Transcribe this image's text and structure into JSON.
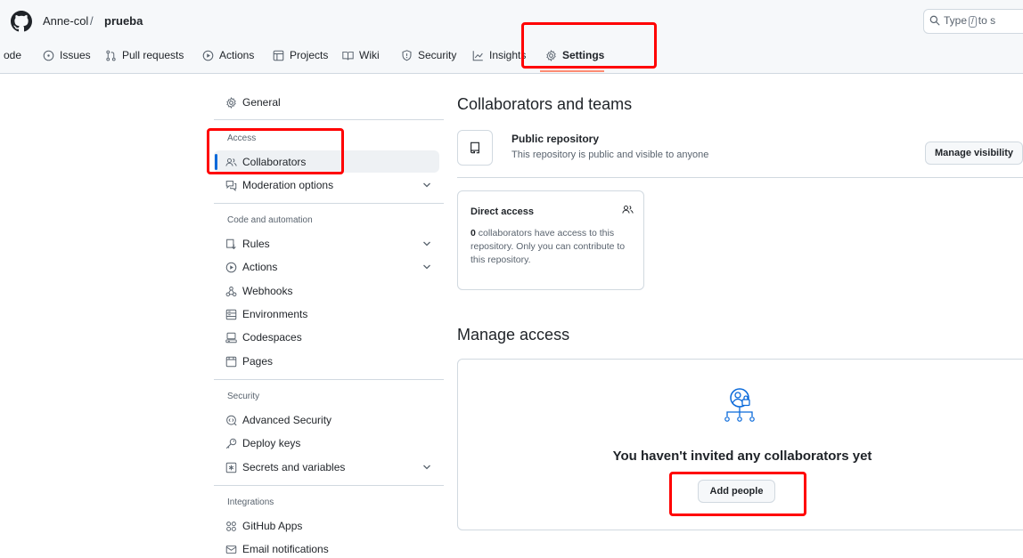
{
  "header": {
    "owner": "Anne-col",
    "separator": "/",
    "repo": "prueba",
    "search_prefix": "Type",
    "search_key": "/",
    "search_suffix": "to s"
  },
  "tabs": [
    {
      "label": "ode",
      "icon": "code-icon"
    },
    {
      "label": "Issues",
      "icon": "issue-icon"
    },
    {
      "label": "Pull requests",
      "icon": "pull-request-icon"
    },
    {
      "label": "Actions",
      "icon": "play-icon"
    },
    {
      "label": "Projects",
      "icon": "table-icon"
    },
    {
      "label": "Wiki",
      "icon": "book-icon"
    },
    {
      "label": "Security",
      "icon": "shield-icon"
    },
    {
      "label": "Insights",
      "icon": "graph-icon"
    },
    {
      "label": "Settings",
      "icon": "gear-icon",
      "active": true
    }
  ],
  "sidebar": {
    "general": "General",
    "access_heading": "Access",
    "collaborators": "Collaborators",
    "moderation": "Moderation options",
    "code_heading": "Code and automation",
    "rules": "Rules",
    "actions": "Actions",
    "webhooks": "Webhooks",
    "environments": "Environments",
    "codespaces": "Codespaces",
    "pages": "Pages",
    "security_heading": "Security",
    "advanced_security": "Advanced Security",
    "deploy_keys": "Deploy keys",
    "secrets": "Secrets and variables",
    "integrations_heading": "Integrations",
    "github_apps": "GitHub Apps",
    "email_notifications": "Email notifications"
  },
  "main": {
    "title": "Collaborators and teams",
    "public_title": "Public repository",
    "public_desc": "This repository is public and visible to anyone",
    "manage_visibility": "Manage visibility",
    "direct_access_title": "Direct access",
    "direct_access_count": "0",
    "direct_access_text": " collaborators have access to this repository. Only you can contribute to this repository.",
    "manage_access_title": "Manage access",
    "empty_title": "You haven't invited any collaborators yet",
    "add_people": "Add people"
  },
  "colors": {
    "annotation_red": "#ff0000",
    "accent_blue": "#0969da",
    "tab_underline": "#fd8c73"
  }
}
